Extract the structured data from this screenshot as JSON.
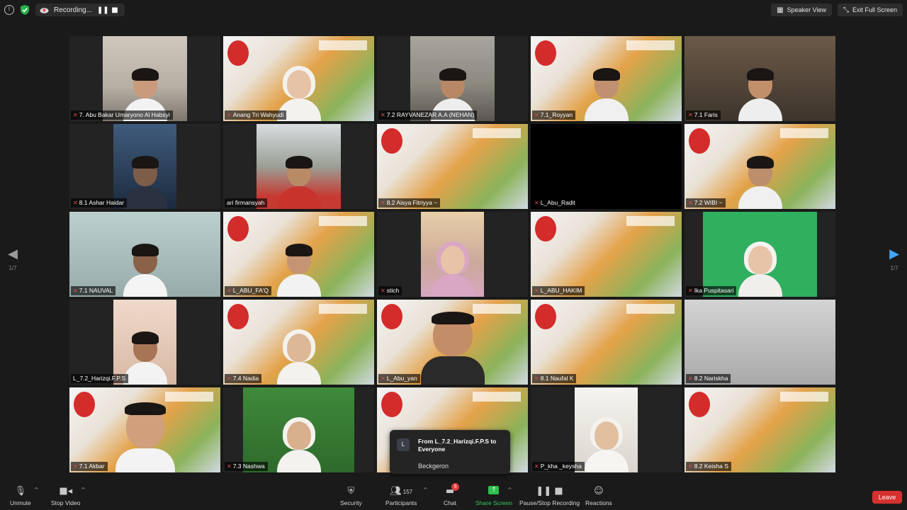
{
  "topbar": {
    "recording_label": "Recording...",
    "speaker_view": "Speaker View",
    "exit_full_screen": "Exit Full Screen"
  },
  "nav": {
    "prev_page": "1/7",
    "next_page": "1/7"
  },
  "participants": [
    {
      "name": "7. Abu Bakar Umaryono Al Habsyi",
      "muted": true
    },
    {
      "name": "Anang Tri Wahyudi",
      "muted": true
    },
    {
      "name": "7.2 RAYVANEZAR A.A (NEHAN)",
      "muted": true
    },
    {
      "name": "7.1_Royyan",
      "muted": true
    },
    {
      "name": "7.1 Faris",
      "muted": true
    },
    {
      "name": "8.1 Ashar Haidar",
      "muted": true
    },
    {
      "name": "ari firmansyah",
      "muted": false
    },
    {
      "name": "8.2 Aisya Fitriyya ~",
      "muted": true
    },
    {
      "name": "L_Abu_Radit",
      "muted": true
    },
    {
      "name": "7.2 WIBI ~",
      "muted": true
    },
    {
      "name": "7.1 NAUVAL",
      "muted": true
    },
    {
      "name": "L_ABU_FA'Q",
      "muted": true
    },
    {
      "name": "stich",
      "muted": true
    },
    {
      "name": "L_ABU_HAKIM",
      "muted": true
    },
    {
      "name": "Ika Puspitasari",
      "muted": true
    },
    {
      "name": "L_7.2_Harizqi.F.P.S",
      "muted": false
    },
    {
      "name": "7.4 Nadia",
      "muted": true
    },
    {
      "name": "L_Abu_yan",
      "muted": true
    },
    {
      "name": "8.1 Naufal K",
      "muted": true
    },
    {
      "name": "8.2 Nariskha",
      "muted": true
    },
    {
      "name": "7.1 Akbar",
      "muted": true
    },
    {
      "name": "7.3 Nashwa",
      "muted": true
    },
    {
      "name": "",
      "muted": false
    },
    {
      "name": "P_kha _keysha",
      "muted": true
    },
    {
      "name": "8.2 Keisha S",
      "muted": true
    }
  ],
  "chat_popup": {
    "avatar_letter": "L",
    "from": "From L_7.2_Harizqi.F.P.S to Everyone",
    "message": "Beckgeron"
  },
  "toolbar": {
    "unmute": "Unmute",
    "stop_video": "Stop Video",
    "security": "Security",
    "participants": "Participants",
    "participants_count": "157",
    "chat": "Chat",
    "chat_badge": "5",
    "share_screen": "Share Screen",
    "recording": "Pause/Stop Recording",
    "reactions": "Reactions",
    "leave": "Leave"
  }
}
